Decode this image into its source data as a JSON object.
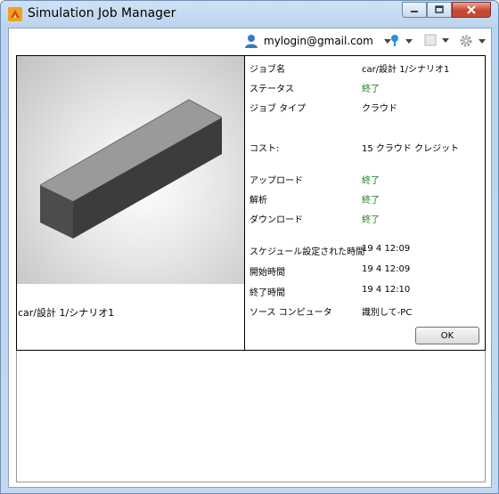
{
  "window": {
    "title": "Simulation Job Manager"
  },
  "toolbar": {
    "user_email": "mylogin@gmail.com"
  },
  "preview": {
    "caption": "car/設計 1/シナリオ1"
  },
  "details": {
    "rows": [
      {
        "label": "ジョブ名",
        "value": "car/設計 1/シナリオ1",
        "status": false
      },
      {
        "label": "ステータス",
        "value": "終了",
        "status": true
      },
      {
        "label": "ジョブ タイプ",
        "value": "クラウド",
        "status": false
      },
      {
        "label": "コスト:",
        "value": "15 クラウド クレジット",
        "status": false
      },
      {
        "label": "アップロード",
        "value": "終了",
        "status": true
      },
      {
        "label": "解析",
        "value": "終了",
        "status": true
      },
      {
        "label": "ダウンロード",
        "value": "終了",
        "status": true
      },
      {
        "label": "スケジュール設定された時間",
        "value": "19 4 12:09",
        "status": false
      },
      {
        "label": "開始時間",
        "value": "19 4 12:09",
        "status": false
      },
      {
        "label": "終了時間",
        "value": "19 4 12:10",
        "status": false
      },
      {
        "label": "ソース コンピュータ",
        "value": "識別して-PC",
        "status": false
      }
    ]
  },
  "actions": {
    "ok_label": "OK"
  },
  "colors": {
    "status_green": "#1a7a1a",
    "close_red": "#c8462f"
  }
}
